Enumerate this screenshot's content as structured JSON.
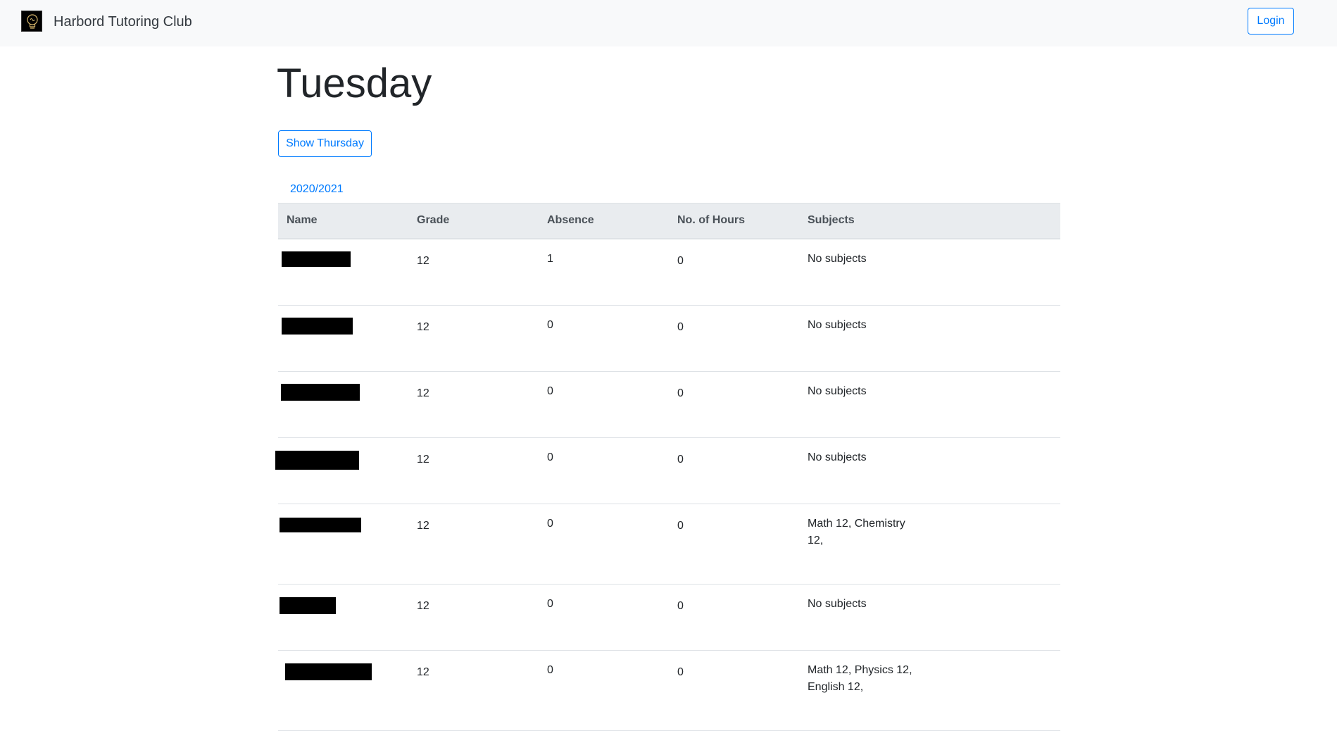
{
  "navbar": {
    "brand": "Harbord Tutoring Club",
    "login_label": "Login"
  },
  "page": {
    "title": "Tuesday",
    "toggle_label": "Show Thursday",
    "year_link": "2020/2021"
  },
  "table": {
    "headers": [
      "Name",
      "Grade",
      "Absence",
      "No. of Hours",
      "Subjects"
    ],
    "rows": [
      {
        "name": "",
        "grade": "12",
        "absence": "1",
        "hours": "0",
        "subjects": "No subjects"
      },
      {
        "name": "",
        "grade": "12",
        "absence": "0",
        "hours": "0",
        "subjects": "No subjects"
      },
      {
        "name": "",
        "grade": "12",
        "absence": "0",
        "hours": "0",
        "subjects": "No subjects"
      },
      {
        "name": "",
        "grade": "12",
        "absence": "0",
        "hours": "0",
        "subjects": "No subjects"
      },
      {
        "name": "",
        "grade": "12",
        "absence": "0",
        "hours": "0",
        "subjects": "Math 12, Chemistry 12,"
      },
      {
        "name": "",
        "grade": "12",
        "absence": "0",
        "hours": "0",
        "subjects": "No subjects"
      },
      {
        "name": "",
        "grade": "12",
        "absence": "0",
        "hours": "0",
        "subjects": "Math 12, Physics 12, English 12,"
      }
    ]
  },
  "colors": {
    "accent": "#007bff",
    "navbar_bg": "#f8f9fa",
    "header_bg": "#e9ecef",
    "redaction": "#000000"
  },
  "icons": {
    "brand": "lightbulb-logo-icon"
  }
}
